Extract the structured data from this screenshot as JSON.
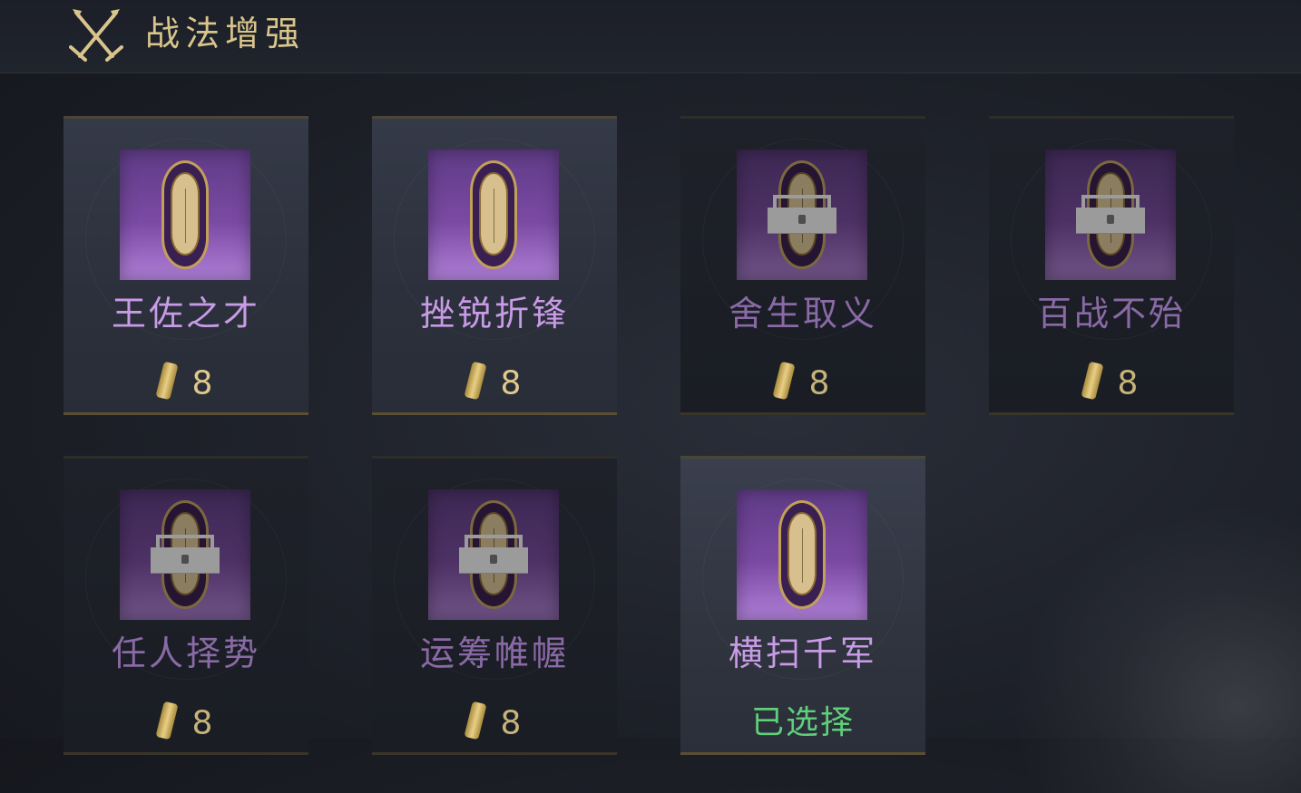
{
  "header": {
    "title": "战法增强",
    "icon": "crossed-swords-icon"
  },
  "colors": {
    "title_gold": "#d9c58c",
    "name_purple": "#c89be6",
    "cost_gold": "#e0c98b",
    "selected_green": "#5fcf7a"
  },
  "cards": [
    {
      "name": "王佐之才",
      "cost": "8",
      "locked": false
    },
    {
      "name": "挫锐折锋",
      "cost": "8",
      "locked": false
    },
    {
      "name": "舍生取义",
      "cost": "8",
      "locked": true
    },
    {
      "name": "百战不殆",
      "cost": "8",
      "locked": true
    },
    {
      "name": "任人择势",
      "cost": "8",
      "locked": true
    },
    {
      "name": "运筹帷幄",
      "cost": "8",
      "locked": true
    },
    {
      "name": "横扫千军",
      "status": "已选择",
      "locked": false,
      "selected": true
    }
  ]
}
